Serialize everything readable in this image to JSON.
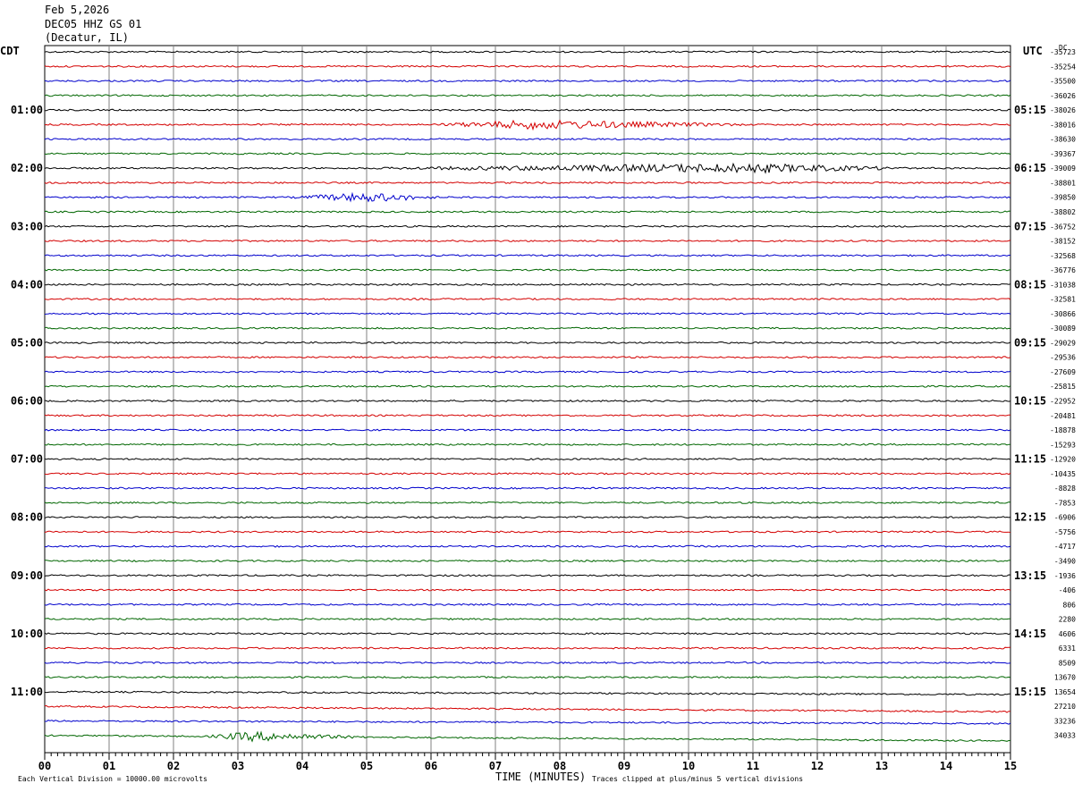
{
  "header": {
    "date": "Feb 5,2026",
    "station": "DEC05 HHZ GS 01",
    "location": "(Decatur, IL)"
  },
  "left_zone": "CDT",
  "right_zone": "UTC",
  "dc_label": "DC",
  "footer": {
    "scale_note": "Each Vertical Division = 10000.00 microvolts",
    "xlabel": "TIME (MINUTES)",
    "clip_note": "Traces clipped at plus/minus 5 vertical divisions"
  },
  "colors": {
    "trace_cycle": [
      "#000000",
      "#d40000",
      "#0000cc",
      "#006600"
    ],
    "grid": "#808080"
  },
  "chart_data": {
    "type": "line",
    "title": "DEC05 HHZ GS 01",
    "xlabel": "TIME (MINUTES)",
    "x_ticks": [
      "00",
      "01",
      "02",
      "03",
      "04",
      "05",
      "06",
      "07",
      "08",
      "09",
      "10",
      "11",
      "12",
      "13",
      "14",
      "15"
    ],
    "xlim": [
      0,
      15
    ],
    "grid": true,
    "row_interval_minutes": 15,
    "rows": 48,
    "left_hour_labels": [
      "01:00",
      "02:00",
      "03:00",
      "04:00",
      "05:00",
      "06:00",
      "07:00",
      "08:00",
      "09:00",
      "10:00",
      "11:00"
    ],
    "right_hour_labels": [
      "05:15",
      "06:15",
      "07:15",
      "08:15",
      "09:15",
      "10:15",
      "11:15",
      "12:15",
      "13:15",
      "14:15",
      "15:15"
    ],
    "row_offsets": [
      "-35723",
      "-35254",
      "-35500",
      "-36026",
      "-38026",
      "-38016",
      "-38630",
      "-39367",
      "-39009",
      "-38801",
      "-39850",
      "-38802",
      "-36752",
      "-38152",
      "-32568",
      "-36776",
      "-31038",
      "-32581",
      "-30866",
      "-30089",
      "-29029",
      "-29536",
      "-27609",
      "-25815",
      "-22952",
      "-20481",
      "-18878",
      "-15293",
      "-12920",
      "-10435",
      "-8828",
      "-7853",
      "-6906",
      "-5756",
      "-4717",
      "-3490",
      "-1936",
      "-406",
      "806",
      "2280",
      "4606",
      "6331",
      "8509",
      "13670",
      "13654",
      "27210",
      "33236",
      "34033"
    ],
    "events": [
      {
        "row": 5,
        "start_min": 6.0,
        "end_min": 11.0,
        "peak_min": 7.6
      },
      {
        "row": 8,
        "start_min": 5.0,
        "end_min": 13.5,
        "peak_min": 11.0
      },
      {
        "row": 10,
        "start_min": 3.8,
        "end_min": 6.2,
        "peak_min": 5.0
      },
      {
        "row": 47,
        "start_min": 2.5,
        "end_min": 5.0,
        "peak_min": 3.2
      }
    ]
  }
}
